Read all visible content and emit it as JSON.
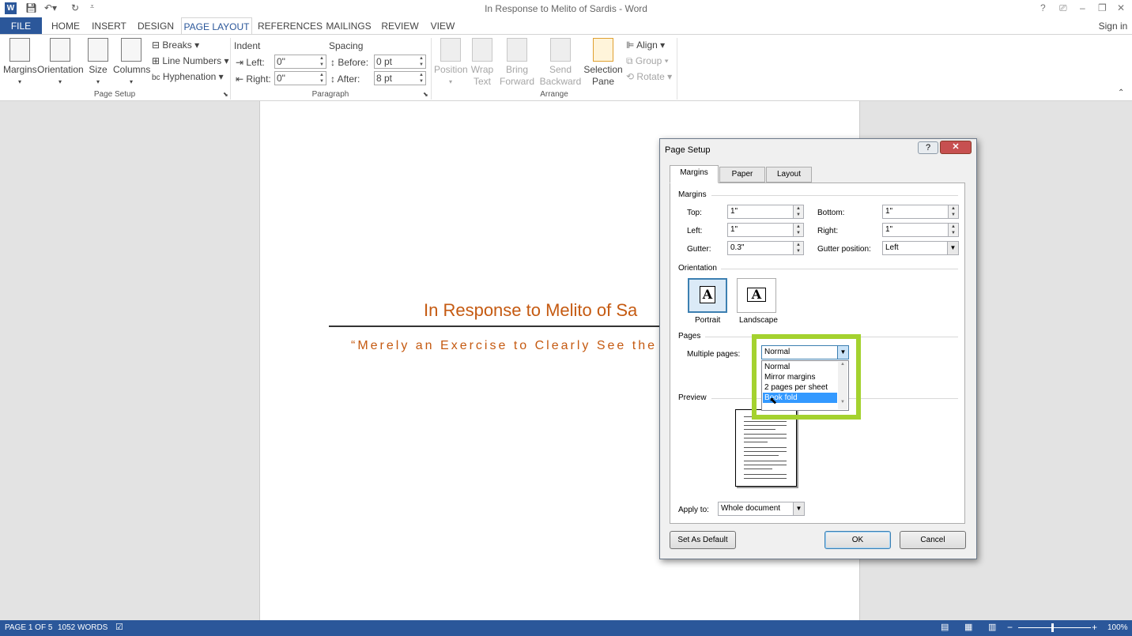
{
  "window": {
    "title": "In Response to Melito of Sardis - Word",
    "sign_in": "Sign in",
    "app_icon": "word-icon",
    "controls": [
      "?",
      "⎚",
      "–",
      "❐",
      "✕"
    ]
  },
  "tabs": [
    "FILE",
    "HOME",
    "INSERT",
    "DESIGN",
    "PAGE LAYOUT",
    "REFERENCES",
    "MAILINGS",
    "REVIEW",
    "VIEW"
  ],
  "active_tab": "PAGE LAYOUT",
  "ribbon": {
    "page_setup": {
      "margins": "Margins",
      "orientation": "Orientation",
      "size": "Size",
      "columns": "Columns",
      "breaks": "Breaks",
      "line_numbers": "Line Numbers",
      "hyphenation": "Hyphenation",
      "label": "Page Setup"
    },
    "paragraph": {
      "indent_label": "Indent",
      "spacing_label": "Spacing",
      "left_label": "Left:",
      "left_value": "0\"",
      "right_label": "Right:",
      "right_value": "0\"",
      "before_label": "Before:",
      "before_value": "0 pt",
      "after_label": "After:",
      "after_value": "8 pt",
      "label": "Paragraph"
    },
    "arrange": {
      "position": "Position",
      "wrap_text_1": "Wrap",
      "wrap_text_2": "Text",
      "bring_forward_1": "Bring",
      "bring_forward_2": "Forward",
      "send_backward_1": "Send",
      "send_backward_2": "Backward",
      "selection_pane_1": "Selection",
      "selection_pane_2": "Pane",
      "align": "Align",
      "group": "Group",
      "rotate": "Rotate",
      "label": "Arrange"
    }
  },
  "document": {
    "heading": "In Response to Melito of Sa",
    "subtitle": "“Merely an Exercise to Clearly See the"
  },
  "dialog": {
    "title": "Page Setup",
    "help": "?",
    "close": "✕",
    "tabs": [
      "Margins",
      "Paper",
      "Layout"
    ],
    "margins_section": "Margins",
    "top_label": "Top:",
    "top_value": "1\"",
    "bottom_label": "Bottom:",
    "bottom_value": "1\"",
    "left_label": "Left:",
    "left_value": "1\"",
    "right_label": "Right:",
    "right_value": "1\"",
    "gutter_label": "Gutter:",
    "gutter_value": "0.3\"",
    "gutter_position_label": "Gutter position:",
    "gutter_position_value": "Left",
    "orientation_section": "Orientation",
    "portrait": "Portrait",
    "landscape": "Landscape",
    "pages_section": "Pages",
    "multiple_pages_label": "Multiple pages:",
    "multiple_pages_value": "Normal",
    "multiple_pages_options": [
      "Normal",
      "Mirror margins",
      "2 pages per sheet",
      "Book fold"
    ],
    "multiple_pages_highlighted": "Book fold",
    "preview_section": "Preview",
    "apply_to_label": "Apply to:",
    "apply_to_value": "Whole document",
    "set_as_default": "Set As Default",
    "ok": "OK",
    "cancel": "Cancel"
  },
  "status": {
    "page": "PAGE 1 OF 5",
    "words": "1052 WORDS",
    "zoom": "100%"
  },
  "colors": {
    "word_blue": "#2b579a",
    "doc_accent": "#c55a11",
    "highlight": "#a4d22f",
    "list_selection": "#3399ff"
  }
}
